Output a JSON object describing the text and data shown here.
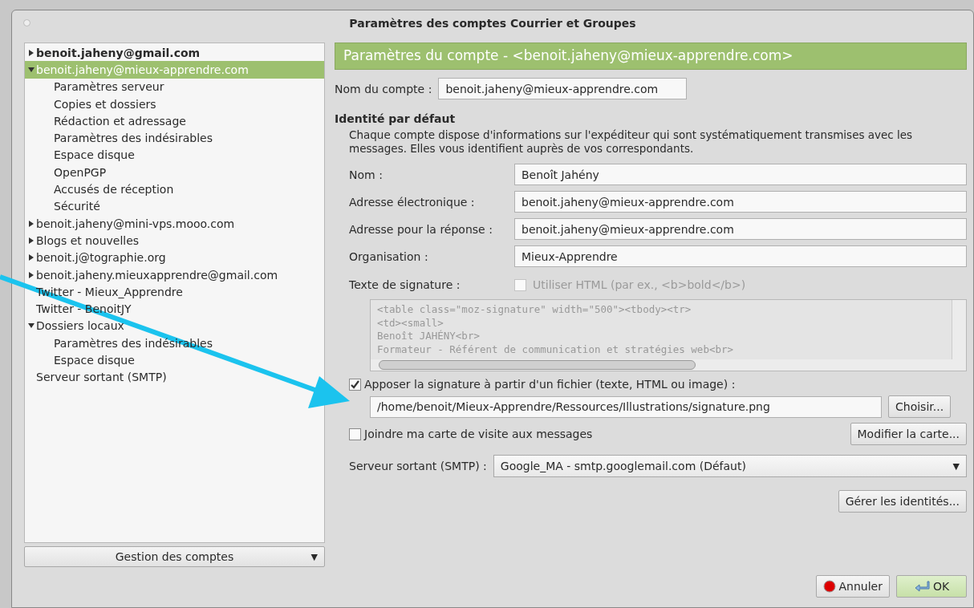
{
  "window": {
    "title": "Paramètres des comptes Courrier et Groupes"
  },
  "tree": [
    {
      "label": "benoit.jaheny@gmail.com",
      "is_default": true,
      "selected": false,
      "expanded": false,
      "has_children": true
    },
    {
      "label": "benoit.jaheny@mieux-apprendre.com",
      "is_default": false,
      "selected": true,
      "expanded": true,
      "has_children": true,
      "children": [
        {
          "label": "Paramètres serveur",
          "selected": false
        },
        {
          "label": "Copies et dossiers",
          "selected": false
        },
        {
          "label": "Rédaction et adressage",
          "selected": false
        },
        {
          "label": "Paramètres des indésirables",
          "selected": false
        },
        {
          "label": "Espace disque",
          "selected": false
        },
        {
          "label": "OpenPGP",
          "selected": false
        },
        {
          "label": "Accusés de réception",
          "selected": false
        },
        {
          "label": "Sécurité",
          "selected": false
        }
      ]
    },
    {
      "label": "benoit.jaheny@mini-vps.mooo.com",
      "is_default": false,
      "selected": false,
      "expanded": false,
      "has_children": true
    },
    {
      "label": "Blogs et nouvelles",
      "is_default": false,
      "selected": false,
      "expanded": false,
      "has_children": true
    },
    {
      "label": "benoit.j@tographie.org",
      "is_default": false,
      "selected": false,
      "expanded": false,
      "has_children": true
    },
    {
      "label": "benoit.jaheny.mieuxapprendre@gmail.com",
      "is_default": false,
      "selected": false,
      "expanded": false,
      "has_children": true
    },
    {
      "label": "Twitter - Mieux_Apprendre",
      "is_default": false,
      "selected": false,
      "expanded": false,
      "has_children": false
    },
    {
      "label": "Twitter - BenoitJY",
      "is_default": false,
      "selected": false,
      "expanded": false,
      "has_children": false
    },
    {
      "label": "Dossiers locaux",
      "is_default": false,
      "selected": false,
      "expanded": true,
      "has_children": true,
      "children": [
        {
          "label": "Paramètres des indésirables",
          "selected": false
        },
        {
          "label": "Espace disque",
          "selected": false
        }
      ]
    },
    {
      "label": "Serveur sortant (SMTP)",
      "is_default": false,
      "selected": false,
      "expanded": false,
      "has_children": false
    }
  ],
  "account_menu": {
    "label": "Gestion des comptes",
    "arrow": "▼"
  },
  "panel": {
    "header": "Paramètres du compte - <benoit.jaheny@mieux-apprendre.com>",
    "account_name": {
      "label": "Nom du compte :",
      "value": "benoit.jaheny@mieux-apprendre.com"
    },
    "identity_title": "Identité par défaut",
    "identity_desc": "Chaque compte dispose d'informations sur l'expéditeur qui sont systématiquement transmises avec les messages. Elles vous identifient auprès de vos correspondants.",
    "fields": [
      {
        "label": "Nom :",
        "value": "Benoît Jahény"
      },
      {
        "label": "Adresse électronique :",
        "value": "benoit.jaheny@mieux-apprendre.com"
      },
      {
        "label": "Adresse pour la réponse :",
        "value": "benoit.jaheny@mieux-apprendre.com"
      },
      {
        "label": "Organisation :",
        "value": "Mieux-Apprendre"
      }
    ],
    "signature_label": "Texte de signature :",
    "use_html": {
      "label": "Utiliser HTML (par ex., <b>bold</b>)",
      "checked": false,
      "disabled": true
    },
    "signature_lines": [
      "<table class=\"moz-signature\" width=\"500\"><tbody><tr>",
      "<td><small>",
      "Benoît JAHÉNY<br>",
      "Formateur - Référent de communication et stratégies web<br>"
    ],
    "sig_file": {
      "label": "Apposer la signature à partir d'un fichier (texte, HTML ou image) :",
      "checked": true
    },
    "sig_path": "/home/benoit/Mieux-Apprendre/Ressources/Illustrations/signature.png",
    "choose_button": "Choisir...",
    "vcard": {
      "label": "Joindre ma carte de visite aux messages",
      "checked": false
    },
    "edit_card_button": "Modifier la carte...",
    "smtp": {
      "label": "Serveur sortant (SMTP) :",
      "value": "Google_MA - smtp.googlemail.com (Défaut)",
      "arrow": "▼"
    },
    "identities_button": "Gérer les identités..."
  },
  "buttons": [
    {
      "kind": "cancel",
      "label": "Annuler"
    },
    {
      "kind": "ok",
      "label": "OK"
    }
  ]
}
